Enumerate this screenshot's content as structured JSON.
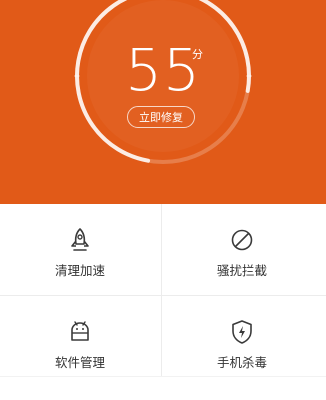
{
  "colors": {
    "hero_bg": "#e15a18",
    "text_dark": "#333333",
    "icon_dark": "#3a3a3a"
  },
  "hero": {
    "score_value": "55",
    "score_unit": "分",
    "fix_button_label": "立即修复"
  },
  "tiles": [
    {
      "label": "清理加速",
      "icon": "rocket-icon"
    },
    {
      "label": "骚扰拦截",
      "icon": "block-icon"
    },
    {
      "label": "软件管理",
      "icon": "android-icon"
    },
    {
      "label": "手机杀毒",
      "icon": "shield-bolt-icon"
    }
  ]
}
